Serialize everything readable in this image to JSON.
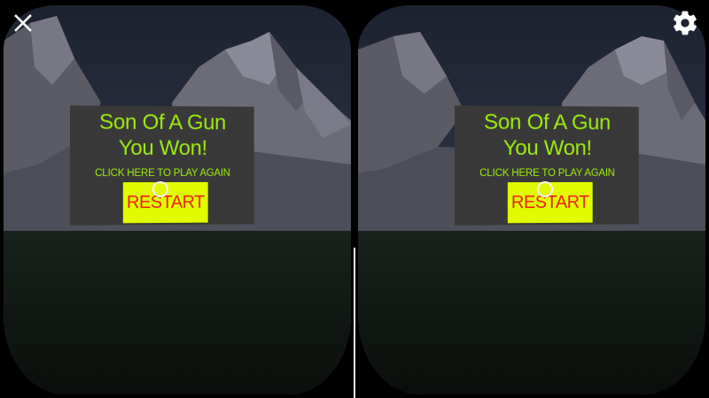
{
  "hud": {
    "close_icon": "close-icon",
    "settings_icon": "gear-icon"
  },
  "game_over_panel": {
    "title": "Son Of A Gun\nYou Won!",
    "subtitle": "CLICK HERE TO PLAY AGAIN",
    "restart_label": "RESTART"
  },
  "colors": {
    "text_green": "#9bec0c",
    "restart_bg": "#e2fb00",
    "restart_text": "#e8210d",
    "panel_bg": "#393939",
    "ground": "#111a14",
    "sky": "#2c3448"
  }
}
